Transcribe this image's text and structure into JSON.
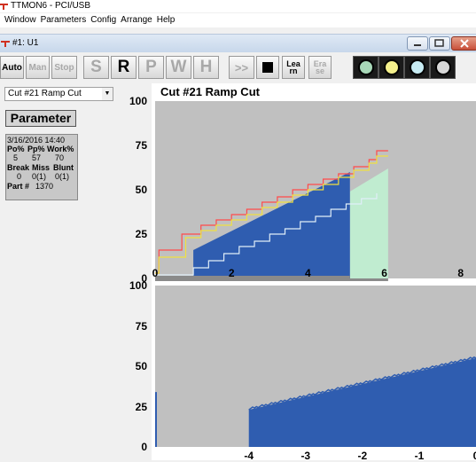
{
  "app": {
    "title": "TTMON6 - PCI/USB"
  },
  "menu": [
    "Window",
    "Parameters",
    "Config",
    "Arrange",
    "Help"
  ],
  "child_window": {
    "title": "#1: U1"
  },
  "toolbar": {
    "auto": "Auto",
    "man": "Man",
    "stop": "Stop",
    "s": "S",
    "r": "R",
    "p": "P",
    "w": "W",
    "h": "H",
    "forward": ">>",
    "learn_top": "Lea",
    "learn_bottom": "rn",
    "erase_top": "Era",
    "erase_bottom": "se"
  },
  "indicator_lights": [
    {
      "name": "light-1",
      "color": "#a8d8b8"
    },
    {
      "name": "light-2",
      "color": "#f4f08c"
    },
    {
      "name": "light-3",
      "color": "#c8ecf4"
    },
    {
      "name": "light-4",
      "color": "#d8d8d8"
    }
  ],
  "left_panel": {
    "selected_cut": "Cut #21 Ramp Cut",
    "parameter_label": "Parameter",
    "datetime": "3/16/2016  14:40",
    "headers1": [
      "Po%",
      "Pp%",
      "Work%"
    ],
    "values1": [
      "5",
      "57",
      "70"
    ],
    "headers2": [
      "Break",
      "Miss",
      "Blunt"
    ],
    "values2": [
      "0",
      "0(1)",
      "0(1)"
    ],
    "part_label": "Part #",
    "part_value": "1370"
  },
  "chart_data": [
    {
      "type": "line",
      "title": "Cut #21 Ramp Cut",
      "yticks": [
        "100",
        "75",
        "50",
        "25",
        "0"
      ],
      "xticks": [
        "0",
        "2",
        "4",
        "6",
        "8"
      ],
      "xlim": [
        0,
        8.4
      ],
      "ylim": [
        0,
        100
      ],
      "series": [
        {
          "color": "#ff4a4a",
          "x": [
            0,
            0.1,
            0.7,
            1.2,
            1.6,
            2.0,
            2.4,
            2.8,
            3.2,
            3.6,
            4.0,
            4.4,
            4.8,
            5.2,
            5.6,
            5.8,
            6.1
          ],
          "y": [
            3,
            16,
            25,
            30,
            33,
            36,
            39,
            43,
            46,
            50,
            53,
            56,
            59,
            63,
            67,
            72,
            72
          ]
        },
        {
          "color": "#f0e040",
          "x": [
            0,
            0.1,
            0.8,
            1.2,
            1.6,
            2.0,
            2.4,
            2.8,
            3.2,
            3.6,
            4.0,
            4.4,
            4.8,
            5.2,
            5.6,
            5.8,
            6.1
          ],
          "y": [
            3,
            12,
            23,
            27,
            30,
            33,
            36,
            40,
            43,
            47,
            50,
            53,
            57,
            61,
            65,
            69,
            69
          ]
        },
        {
          "color": "#2f5db0",
          "x": [
            1.0,
            5.1
          ],
          "y": [
            16,
            60
          ]
        },
        {
          "color": "#c0ecd0",
          "x": [
            5.1,
            6.1
          ],
          "y": [
            49,
            62
          ]
        },
        {
          "color": "#e0eef8",
          "x": [
            0,
            0.7,
            1.0,
            1.4,
            1.8,
            2.2,
            2.6,
            3.0,
            3.4,
            3.8,
            4.2,
            4.6,
            5.0,
            5.4,
            5.8
          ],
          "y": [
            2,
            2,
            6,
            10,
            14,
            18,
            21,
            25,
            28,
            32,
            35,
            39,
            42,
            45,
            48
          ]
        }
      ]
    },
    {
      "type": "area",
      "title": "",
      "yticks": [
        "100",
        "75",
        "50",
        "25",
        "0"
      ],
      "xticks": [
        "-4",
        "-3",
        "-2",
        "-1",
        "0"
      ],
      "xlim": [
        -5.65,
        0
      ],
      "ylim": [
        0,
        100
      ],
      "series": [
        {
          "color": "#2f5db0",
          "x": [
            -4,
            0
          ],
          "y": [
            23,
            55
          ]
        }
      ]
    }
  ]
}
